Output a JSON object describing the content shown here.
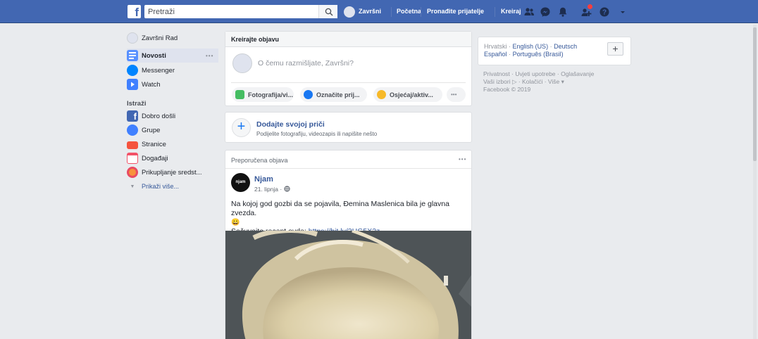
{
  "topbar": {
    "logo_letter": "f",
    "search_placeholder": "Pretraži",
    "profile_name": "Završni",
    "links": [
      "Početna",
      "Pronađite prijatelje",
      "Kreiraj"
    ]
  },
  "left_nav": {
    "profile_name": "Završni Rad",
    "shortcuts": [
      "Novosti",
      "Messenger",
      "Watch"
    ],
    "explore_heading": "Istraži",
    "explore": [
      "Dobro došli",
      "Grupe",
      "Stranice",
      "Događaji",
      "Prikupljanje sredst..."
    ],
    "see_more": "Prikaži više..."
  },
  "composer": {
    "header": "Kreirajte objavu",
    "placeholder": "O čemu razmišljate, Završni?",
    "actions": [
      "Fotografija/vi...",
      "Označite prij...",
      "Osjećaj/aktiv..."
    ],
    "more": "•••"
  },
  "story": {
    "title": "Dodajte svojoj priči",
    "subtitle": "Podijelite fotografiju, videozapis ili napišite nešto"
  },
  "post": {
    "header": "Preporučena objava",
    "author": "Njam",
    "avatar_text": "njam",
    "date": "21. lipnja",
    "text": "Na kojoj god gozbi da se pojavila, Ðemina Maslenica bila je glavna zvezda.",
    "emoji": "😀",
    "recipe_label": "Sačuvajte recept ovde:",
    "recipe_link": "https://bit.ly/2HG5X2z"
  },
  "right": {
    "languages_line1": [
      "Hrvatski",
      "English (US)",
      "Deutsch"
    ],
    "languages_line2": [
      "Español",
      "Português (Brasil)"
    ],
    "add_label": "+",
    "footer_line1": [
      "Privatnost",
      "Uvjeti upotrebe",
      "Oglašavanje"
    ],
    "footer_line2": [
      "Vaši izbori ▷",
      "Kolačići",
      "Više ▾"
    ],
    "copyright": "Facebook © 2019"
  },
  "colors": {
    "brand": "#4267b2",
    "background": "#e9ebee",
    "link": "#365899",
    "notification": "#fa3e3e"
  },
  "icons": [
    "search-icon",
    "friends-icon",
    "messenger-icon",
    "bell-icon",
    "quick-help-icon",
    "help-icon",
    "caret-down-icon"
  ]
}
